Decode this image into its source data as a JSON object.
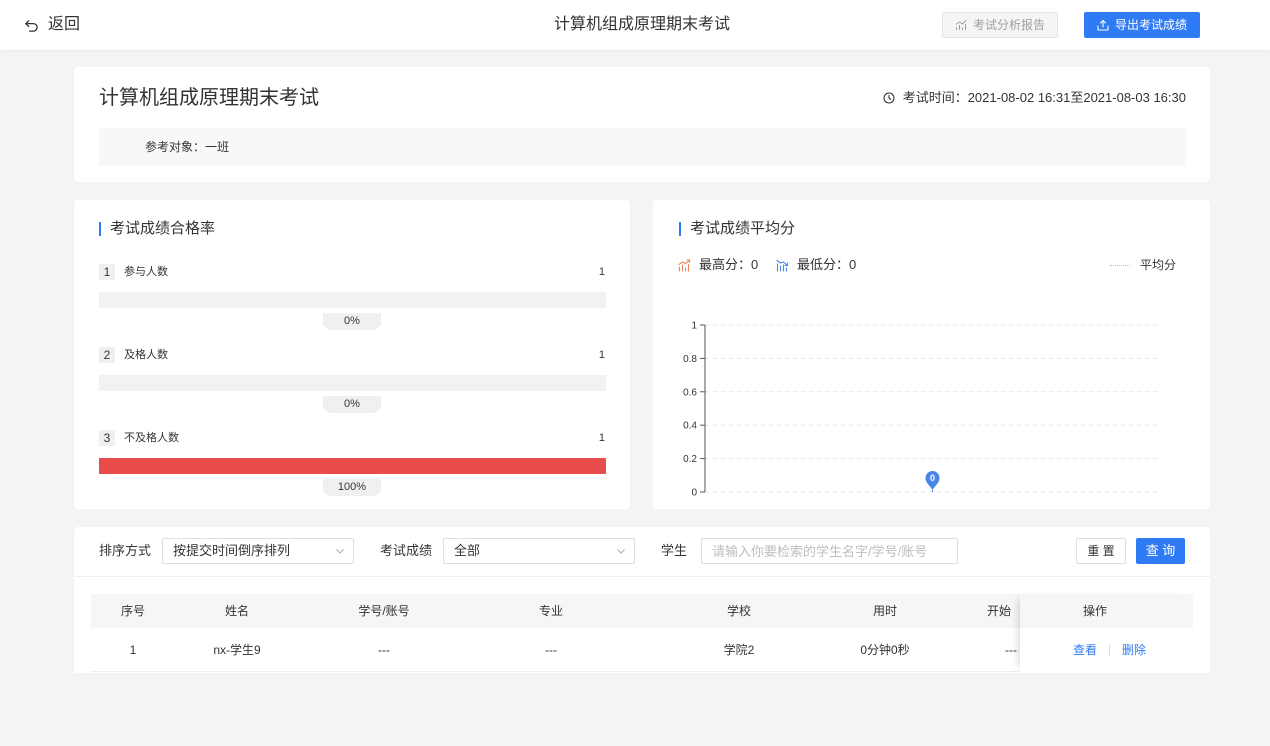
{
  "colors": {
    "primary": "#2f7bf5",
    "page_background": "#f3f4f6",
    "max_icon": "#f0845a",
    "min_icon": "#4a86e8"
  },
  "header": {
    "back_icon": "undo-arrow-icon",
    "back_label": "返回",
    "title": "计算机组成原理期末考试",
    "report_icon": "chart-icon",
    "report_button": "考试分析报告",
    "report_disabled": true,
    "export_icon": "upload-icon",
    "export_button": "导出考试成绩"
  },
  "exam": {
    "title": "计算机组成原理期末考试",
    "time_icon": "clock-icon",
    "time_label": "考试时间：",
    "time_value": "2021-08-02 16:31至2021-08-03 16:30",
    "target_label": "参考对象：",
    "target_value": "一班"
  },
  "pass_rate": {
    "title": "考试成绩合格率",
    "items": [
      {
        "index": "1",
        "label": "参与人数",
        "count": "1",
        "percent_label": "0%",
        "fill": 0
      },
      {
        "index": "2",
        "label": "及格人数",
        "count": "1",
        "percent_label": "0%",
        "fill": 0
      },
      {
        "index": "3",
        "label": "不及格人数",
        "count": "1",
        "percent_label": "100%",
        "fill": 1,
        "color": "#e84b4b"
      }
    ]
  },
  "score_stats": {
    "max_icon": "trend-up-icon",
    "max_label": "最高分：",
    "max_value": "0",
    "min_icon": "trend-down-icon",
    "min_label": "最低分：",
    "min_value": "0"
  },
  "chart_data": {
    "type": "line",
    "title": "考试成绩平均分",
    "ylim": [
      0,
      1
    ],
    "yticks": [
      0,
      0.2,
      0.4,
      0.6,
      0.8,
      1
    ],
    "grid": true,
    "legend": "top-right",
    "series": [
      {
        "name": "平均分",
        "values": [
          0
        ],
        "color": "#4a86e8"
      }
    ]
  },
  "filters": {
    "sort_label": "排序方式",
    "sort_value": "按提交时间倒序排列",
    "score_label": "考试成绩",
    "score_value": "全部",
    "student_label": "学生",
    "student_placeholder": "请输入你要检索的学生名字/学号/账号",
    "reset_button": "重 置",
    "search_button": "查 询"
  },
  "table": {
    "columns": [
      "序号",
      "姓名",
      "学号/账号",
      "专业",
      "学校",
      "用时",
      "开始",
      "操作"
    ],
    "rows": [
      {
        "cells": [
          "1",
          "nx-学生9",
          "---",
          "---",
          "学院2",
          "0分钟0秒",
          "---"
        ],
        "actions": [
          "查看",
          "删除"
        ]
      }
    ]
  }
}
